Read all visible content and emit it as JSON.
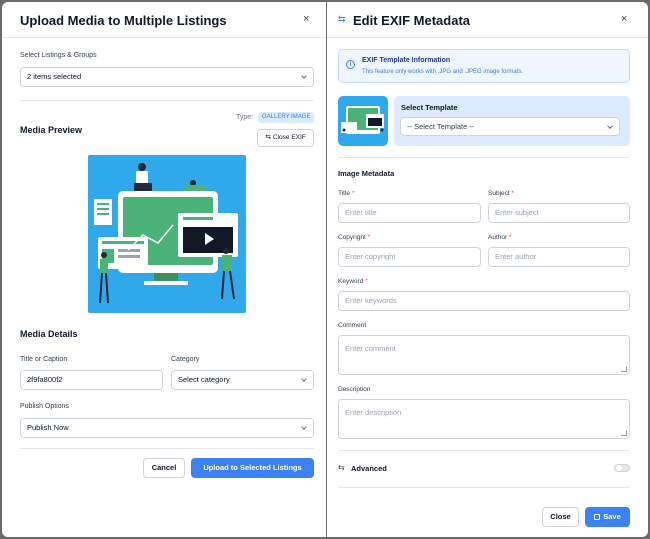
{
  "upload": {
    "title": "Upload Media to Multiple Listings",
    "close": "×",
    "listings_label": "Select Listings & Groups",
    "listings_value": "2 items selected",
    "preview_title": "Media Preview",
    "type_label": "Type:",
    "type_badge": "GALLERY IMAGE",
    "close_exif": "Close EXIF",
    "details_title": "Media Details",
    "caption_label": "Title or Caption",
    "caption_value": "2f9fa800f2",
    "category_label": "Category",
    "category_value": "Select category",
    "publish_label": "Publish Options",
    "publish_value": "Publish Now",
    "cancel": "Cancel",
    "submit": "Upload to Selected Listings"
  },
  "exif": {
    "title": "Edit EXIF Metadata",
    "close": "×",
    "info_title": "EXIF Template Information",
    "info_text": "This feature only works with .JPG and .JPEG image formats.",
    "template_label": "Select Template",
    "template_value": "-- Select Template --",
    "metadata_title": "Image Metadata",
    "title_label": "Title",
    "title_ph": "Enter title",
    "subject_label": "Subject",
    "subject_ph": "Enter subject",
    "copyright_label": "Copyright",
    "copyright_ph": "Enter copyright",
    "author_label": "Author",
    "author_ph": "Enter author",
    "keyword_label": "Keyword",
    "keyword_ph": "Enter keywords",
    "comment_label": "Comment",
    "comment_ph": "Enter comment",
    "description_label": "Description",
    "description_ph": "Enter description",
    "req": "*",
    "advanced": "Advanced",
    "close_btn": "Close",
    "save": "Save"
  },
  "colors": {
    "accent": "#3b82f6",
    "illustration_bg": "#2fa9ec",
    "green": "#4bb377"
  }
}
